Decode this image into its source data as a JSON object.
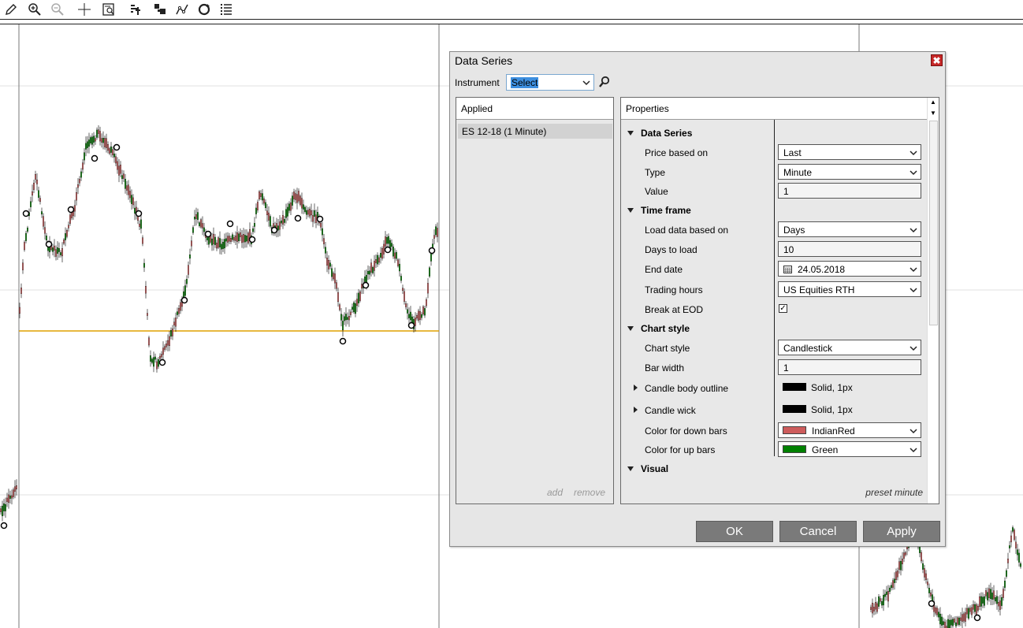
{
  "toolbar": {
    "icons": [
      "pencil-icon",
      "zoom-in-icon",
      "zoom-out-icon",
      "crosshair-icon",
      "data-box-icon",
      "bar-type-icon",
      "chart-style-icon",
      "drawing-tools-icon",
      "refresh-icon",
      "properties-list-icon"
    ]
  },
  "chart": {
    "horizontal_line_color": "#e0a000",
    "candle_up_color": "#008000",
    "candle_down_color": "#cd5c5c"
  },
  "dialog": {
    "title": "Data Series",
    "instrument": {
      "label": "Instrument",
      "value": "Select"
    },
    "applied": {
      "header": "Applied",
      "items": [
        "ES 12-18 (1 Minute)"
      ],
      "add_label": "add",
      "remove_label": "remove"
    },
    "properties": {
      "header": "Properties",
      "sections": {
        "data_series": "Data Series",
        "time_frame": "Time frame",
        "chart_style": "Chart style",
        "visual": "Visual"
      },
      "rows": {
        "price_based_on": {
          "label": "Price based on",
          "value": "Last"
        },
        "type": {
          "label": "Type",
          "value": "Minute"
        },
        "value": {
          "label": "Value",
          "value": "1"
        },
        "load_data_based_on": {
          "label": "Load data based on",
          "value": "Days"
        },
        "days_to_load": {
          "label": "Days to load",
          "value": "10"
        },
        "end_date": {
          "label": "End date",
          "value": "24.05.2018"
        },
        "trading_hours": {
          "label": "Trading hours",
          "value": "US Equities RTH"
        },
        "break_at_eod": {
          "label": "Break at EOD",
          "checked": true,
          "mark": "✓"
        },
        "chart_style": {
          "label": "Chart style",
          "value": "Candlestick"
        },
        "bar_width": {
          "label": "Bar width",
          "value": "1"
        },
        "candle_body_outline": {
          "label": "Candle body outline",
          "value": "Solid, 1px"
        },
        "candle_wick": {
          "label": "Candle wick",
          "value": "Solid, 1px"
        },
        "color_down_bars": {
          "label": "Color for down bars",
          "value": "IndianRed",
          "color": "#cd5c5c"
        },
        "color_up_bars": {
          "label": "Color for up bars",
          "value": "Green",
          "color": "#008000"
        }
      },
      "preset_label": "preset minute"
    },
    "buttons": {
      "ok": "OK",
      "cancel": "Cancel",
      "apply": "Apply"
    },
    "close_glyph": "✖"
  }
}
